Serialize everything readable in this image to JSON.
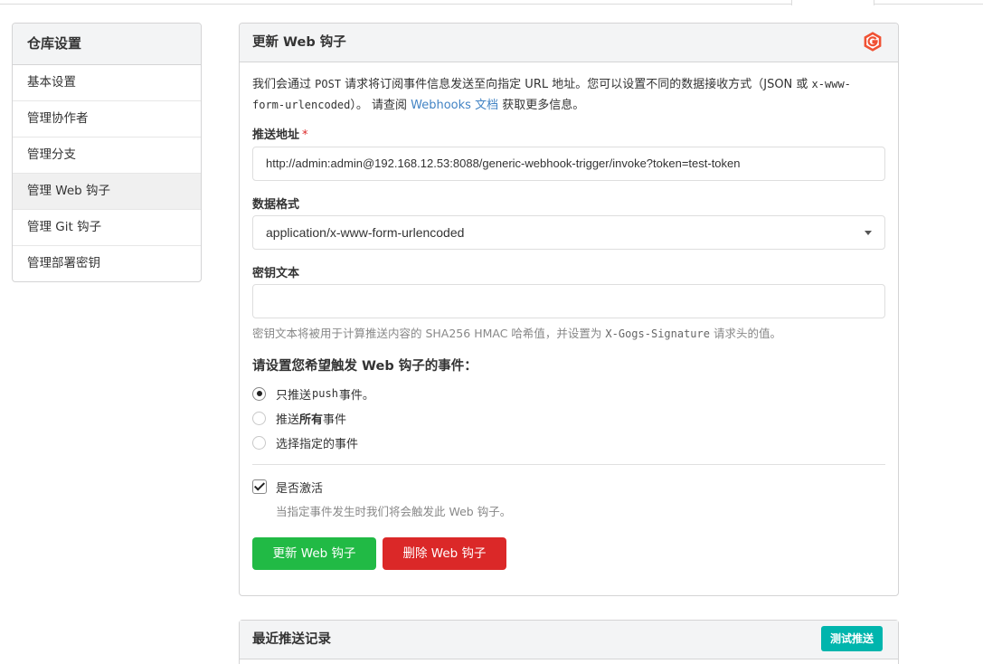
{
  "sidebar": {
    "title": "仓库设置",
    "items": [
      {
        "label": "基本设置"
      },
      {
        "label": "管理协作者"
      },
      {
        "label": "管理分支"
      },
      {
        "label": "管理 Web 钩子"
      },
      {
        "label": "管理 Git 钩子"
      },
      {
        "label": "管理部署密钥"
      }
    ]
  },
  "panel": {
    "title": "更新 Web 钩子",
    "logo_icon": "gogs-logo-icon",
    "desc_part1": "我们会通过 ",
    "desc_post": "POST",
    "desc_part2": " 请求将订阅事件信息发送至向指定 URL 地址。您可以设置不同的数据接收方式（JSON 或 ",
    "desc_form": "x-www-form-urlencoded",
    "desc_part3": "）。 请查阅 ",
    "desc_link": "Webhooks 文档",
    "desc_part4": " 获取更多信息。"
  },
  "form": {
    "url_label": "推送地址",
    "required_mark": "*",
    "url_value": "http://admin:admin@192.168.12.53:8088/generic-webhook-trigger/invoke?token=test-token",
    "content_type_label": "数据格式",
    "content_type_value": "application/x-www-form-urlencoded",
    "secret_label": "密钥文本",
    "secret_value": "",
    "secret_help_part1": "密钥文本将被用于计算推送内容的 SHA256 HMAC 哈希值，并设置为 ",
    "secret_help_header": "X-Gogs-Signature",
    "secret_help_part2": " 请求头的值。"
  },
  "events": {
    "title": "请设置您希望触发 Web 钩子的事件：",
    "opt_push_a": "只推送 ",
    "opt_push_code": "push",
    "opt_push_b": " 事件。",
    "opt_all_a": "推送 ",
    "opt_all_bold": "所有",
    "opt_all_b": " 事件",
    "opt_choose": "选择指定的事件",
    "selected": "push_only"
  },
  "active": {
    "label": "是否激活",
    "checked": true,
    "help": "当指定事件发生时我们将会触发此 Web 钩子。"
  },
  "buttons": {
    "update": "更新 Web 钩子",
    "delete": "删除 Web 钩子"
  },
  "deliveries": {
    "title": "最近推送记录",
    "test_button": "测试推送"
  },
  "colors": {
    "green": "#21ba45",
    "red": "#db2828",
    "teal": "#00b5ad",
    "link": "#4183c4",
    "gogs_orange": "#f05133"
  }
}
